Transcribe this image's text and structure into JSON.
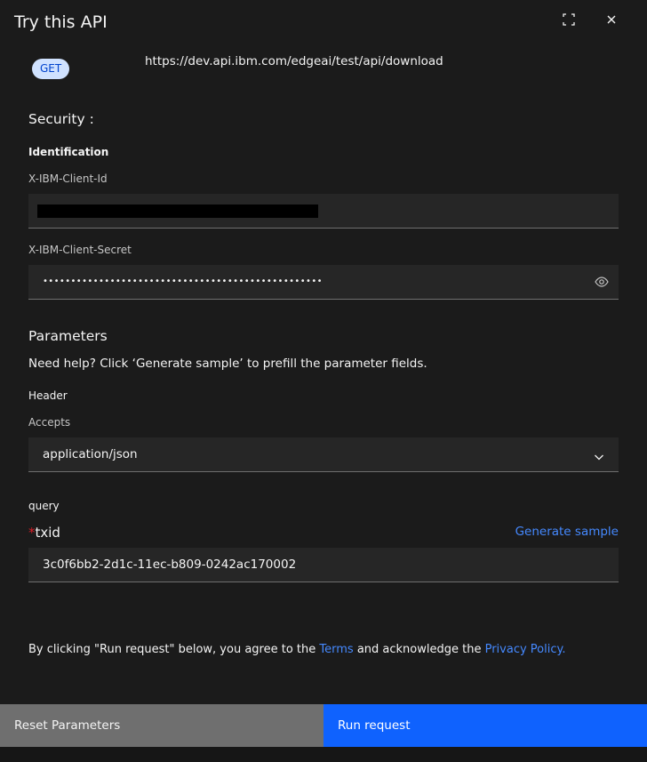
{
  "modal": {
    "title": "Try this API",
    "method": "GET",
    "url": "https://dev.api.ibm.com/edgeai/test/api/download"
  },
  "security": {
    "heading": "Security :",
    "identification_label": "Identification",
    "client_id_label": "X-IBM-Client-Id",
    "client_secret_label": "X-IBM-Client-Secret",
    "client_secret_value": "••••••••••••••••••••••••••••••••••••••••••••••••••"
  },
  "parameters": {
    "heading": "Parameters",
    "help_text": "Need help? Click ‘Generate sample’ to prefill the parameter fields.",
    "header_group": "Header",
    "accepts_label": "Accepts",
    "accepts_value": "application/json",
    "query_group": "query",
    "required_marker": "*",
    "txid_label": "txid",
    "generate_sample_link": "Generate sample",
    "txid_value": "3c0f6bb2-2d1c-11ec-b809-0242ac170002"
  },
  "agreement": {
    "prefix": "By clicking \"Run request\" below, you agree to the ",
    "terms_link": "Terms",
    "middle": " and acknowledge the ",
    "privacy_link": "Privacy Policy."
  },
  "footer": {
    "reset_label": "Reset Parameters",
    "run_label": "Run request"
  },
  "colors": {
    "background": "#1b1b1b",
    "field": "#262626",
    "accent": "#0f62fe",
    "link": "#4589ff",
    "required": "#da1e28",
    "tag_bg": "#d0e2ff",
    "tag_fg": "#0043ce",
    "secondary_button": "#6f6f6f"
  },
  "icons": {
    "expand": "maximize-icon",
    "close": "close-icon",
    "show_password": "eye-icon",
    "dropdown": "chevron-down-icon"
  }
}
